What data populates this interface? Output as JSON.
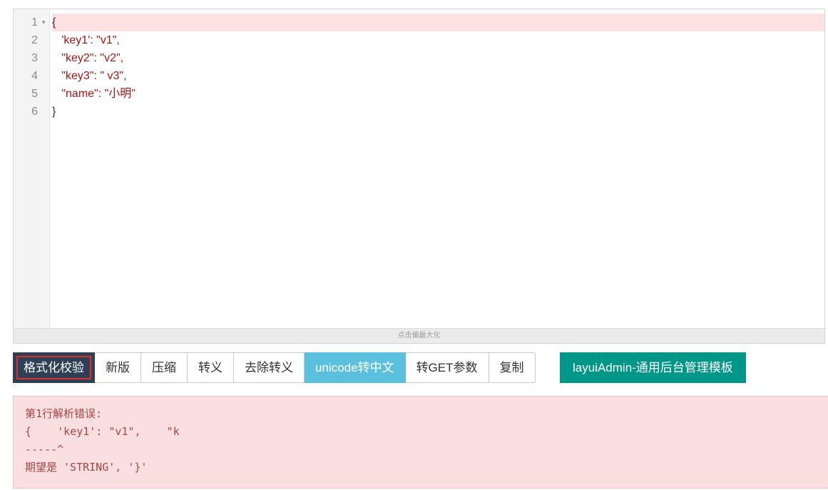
{
  "editor": {
    "lines": [
      {
        "number": "1",
        "text": "{"
      },
      {
        "number": "2",
        "text": "   'key1': \"v1\","
      },
      {
        "number": "3",
        "text": "   \"key2\": \"v2\","
      },
      {
        "number": "4",
        "text": "   \"key3\": \" v3\","
      },
      {
        "number": "5",
        "text": "   \"name\": \"小明\""
      },
      {
        "number": "6",
        "text": "}"
      }
    ],
    "fold_marker": "▾",
    "resize_hint": "点击偏最大化"
  },
  "toolbar": {
    "format_validate": "格式化校验",
    "new_version": "新版",
    "compress": "压缩",
    "escape": "转义",
    "unescape": "去除转义",
    "unicode_to_chinese": "unicode转中文",
    "to_get_params": "转GET参数",
    "copy": "复制",
    "promo": "layuiAdmin-通用后台管理模板"
  },
  "error": {
    "lines": [
      "第1行解析错误:",
      "{    'key1': \"v1\",    \"k",
      "-----^",
      "期望是 'STRING', '}'"
    ]
  },
  "colors": {
    "active_line": "#fbe1e1",
    "primary_button": "#2f4056",
    "info_button": "#5bc0de",
    "promo_button": "#009688",
    "error_bg": "#f9dfe0",
    "error_text": "#a94442"
  }
}
